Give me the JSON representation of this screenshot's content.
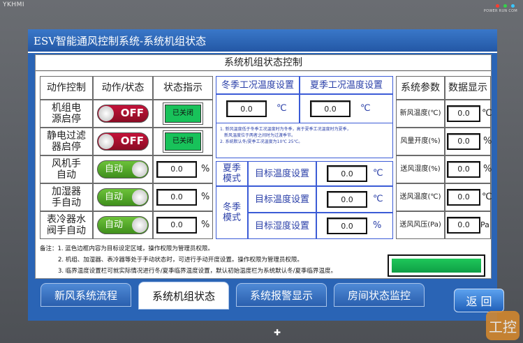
{
  "device": {
    "brand": "YKHMI",
    "led_labels": "POWER RUN COM",
    "led_colors": [
      "#ff3b2f",
      "#35d14a",
      "#39c6ff"
    ]
  },
  "window": {
    "title": "ESV智能通风控制系统-系统机组状态"
  },
  "panel": {
    "title": "系统机组状态控制"
  },
  "left_table": {
    "headers": [
      "动作控制",
      "动作/状态",
      "状态指示"
    ],
    "rows": [
      {
        "name_l1": "机组电",
        "name_l2": "源启停",
        "control": "OFF",
        "indicator": "已关闭"
      },
      {
        "name_l1": "静电过滤",
        "name_l2": "器启停",
        "control": "OFF",
        "indicator": "已关闭"
      },
      {
        "name_l1": "风机手",
        "name_l2": "自动",
        "control": "自动",
        "value": "0.0",
        "unit": "%"
      },
      {
        "name_l1": "加湿器",
        "name_l2": "手自动",
        "control": "自动",
        "value": "0.0",
        "unit": "%"
      },
      {
        "name_l1": "表冷器水",
        "name_l2": "阀手自动",
        "control": "自动",
        "value": "0.0",
        "unit": "%"
      }
    ]
  },
  "temp_settings": {
    "winter_label": "冬季工况温度设置",
    "summer_label": "夏季工况温度设置",
    "winter_value": "0.0",
    "summer_value": "0.0",
    "unit": "℃",
    "note1": "1. 新风温度低于冬季工况温度时为冬季，高于夏季工况温度时为夏季，",
    "note1b": "新风温度位于两者之间时为过渡季节。",
    "note2": "2. 系统默认冬/夏季工况温度为10℃  25℃。"
  },
  "target_settings": {
    "summer_mode_l1": "夏季",
    "summer_mode_l2": "模式",
    "winter_mode_l1": "冬季",
    "winter_mode_l2": "模式",
    "rows": [
      {
        "label": "目标温度设置",
        "value": "0.0",
        "unit": "℃"
      },
      {
        "label": "目标温度设置",
        "value": "0.0",
        "unit": "℃"
      },
      {
        "label": "目标湿度设置",
        "value": "0.0",
        "unit": "%"
      }
    ]
  },
  "params": {
    "headers": [
      "系统参数",
      "数据显示"
    ],
    "rows": [
      {
        "label": "新风温度(℃)",
        "value": "0.0",
        "unit": "℃"
      },
      {
        "label": "风量开度(%)",
        "value": "0.0",
        "unit": "%"
      },
      {
        "label": "送风湿度(%)",
        "value": "0.0",
        "unit": "%"
      },
      {
        "label": "送风温度(℃)",
        "value": "0.0",
        "unit": "℃"
      },
      {
        "label": "送风风压(Pa)",
        "value": "0.0",
        "unit": "Pa"
      }
    ]
  },
  "notes": {
    "line1": "备注：1. 蓝色边框内容为目标设定区域，操作权限为管理员权限。",
    "line2": "2. 机组、加湿器、表冷器等处于手动状态时，可进行手动开度设置。操作权限为管理员权限。",
    "line3": "3. 临界温度设置栏可就实际情况进行冬/夏季临界温度设置，默认初始温度栏为系统默认冬/夏季临界温度。"
  },
  "tabs": [
    "新风系统流程",
    "系统机组状态",
    "系统报警显示",
    "房间状态监控"
  ],
  "back_button": "返  回",
  "watermark": "工控"
}
